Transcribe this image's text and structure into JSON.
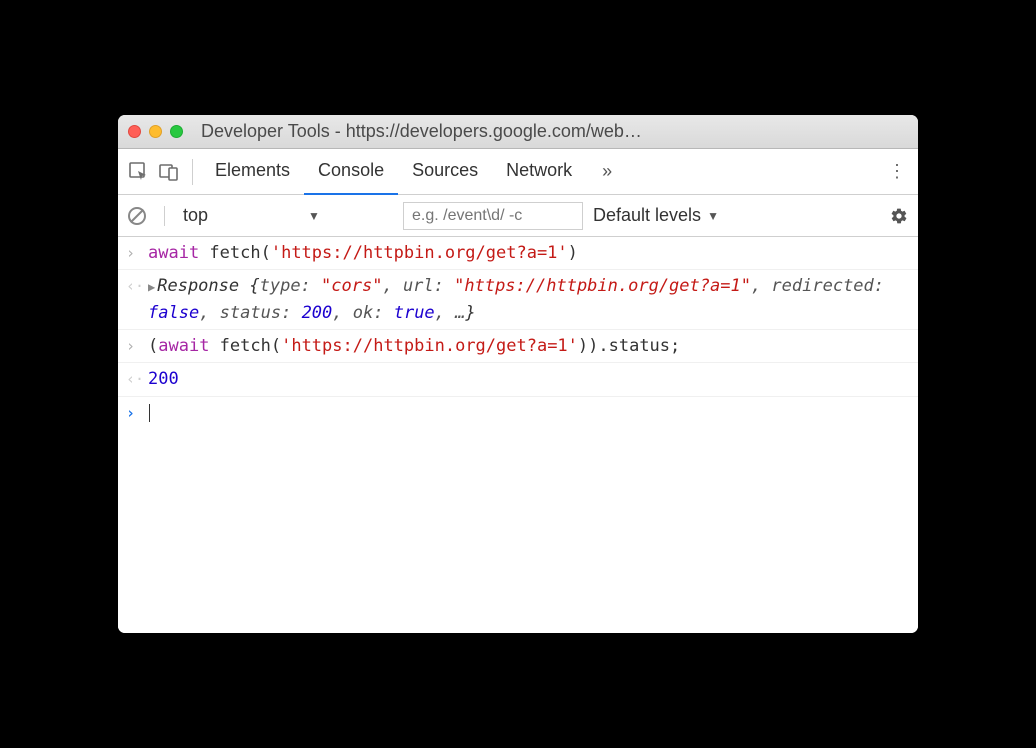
{
  "window": {
    "title": "Developer Tools - https://developers.google.com/web…"
  },
  "tabs": {
    "elements": "Elements",
    "console": "Console",
    "sources": "Sources",
    "network": "Network",
    "more": "»",
    "menu": "⋮"
  },
  "filter": {
    "context": "top",
    "placeholder": "e.g. /event\\d/ -c",
    "levels": "Default levels"
  },
  "console": {
    "line1": {
      "kw": "await",
      "fn": " fetch(",
      "str": "'https://httpbin.org/get?a=1'",
      "end": ")"
    },
    "line2": {
      "obj": "Response ",
      "open": "{",
      "p1": "type: ",
      "v1": "\"cors\"",
      "c1": ", ",
      "p2": "url: ",
      "v2": "\"https://httpbin.org/get?a=1\"",
      "c2": ", ",
      "p3": "redirected: ",
      "v3": "false",
      "c3": ", ",
      "p4": "status: ",
      "v4": "200",
      "c4": ", ",
      "p5": "ok: ",
      "v5": "true",
      "c5": ", …",
      "close": "}"
    },
    "line3": {
      "open": "(",
      "kw": "await",
      "fn": " fetch(",
      "str": "'https://httpbin.org/get?a=1'",
      "end": ")).status;"
    },
    "line4": {
      "val": "200"
    }
  }
}
